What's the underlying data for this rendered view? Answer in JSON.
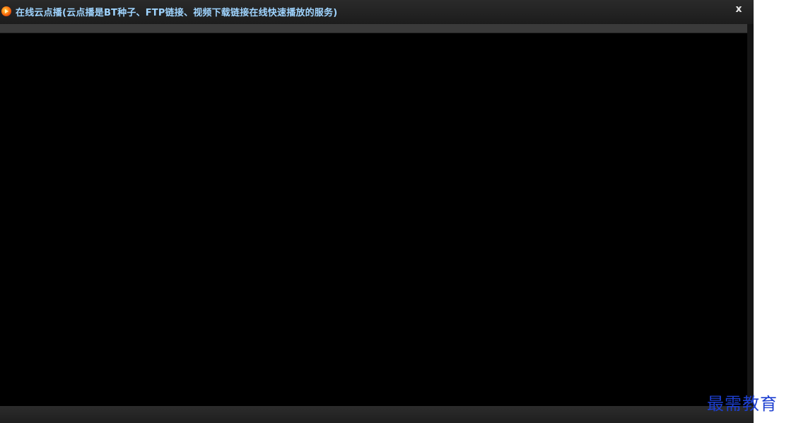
{
  "window": {
    "title": "在线云点播(云点播是BT种子、FTP链接、视频下载链接在线快速播放的服务)",
    "app_icon": "play-logo-icon",
    "close_label": "x"
  },
  "watermark": {
    "text": "最需教育"
  }
}
